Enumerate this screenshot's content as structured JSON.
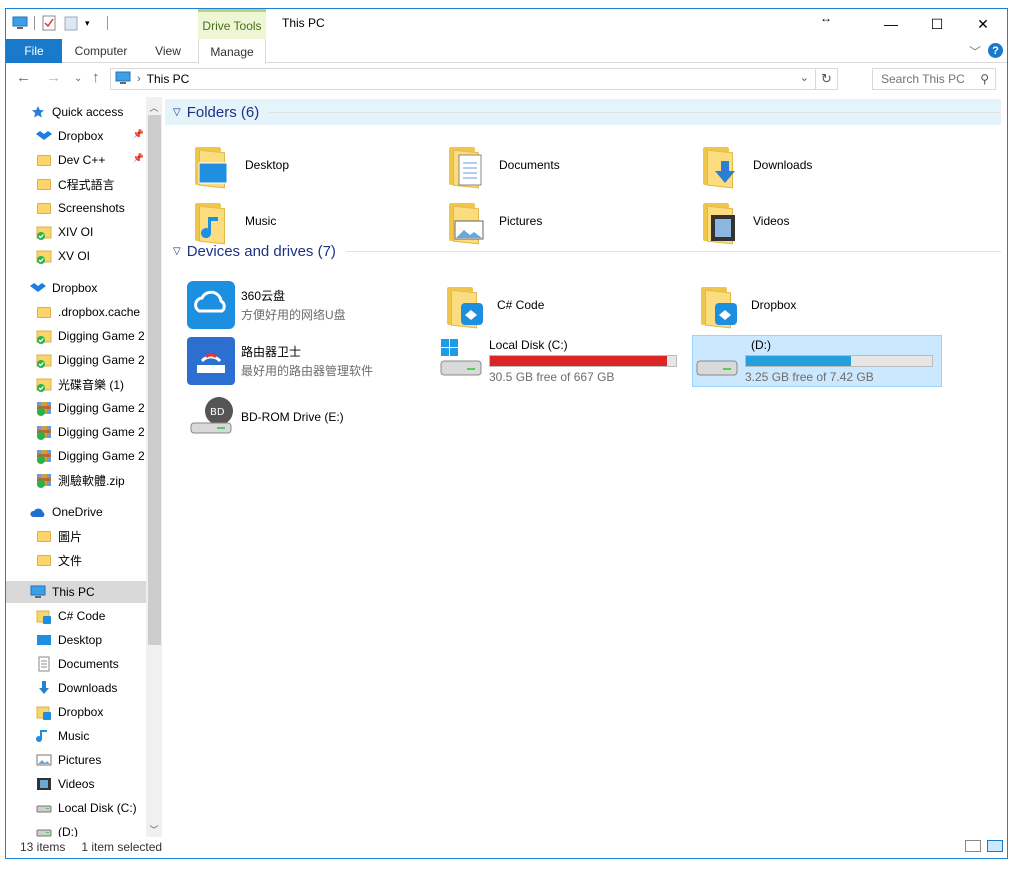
{
  "window": {
    "title": "This PC",
    "context_tab_group": "Drive Tools",
    "controls": {
      "minimize": "—",
      "maximize": "☐",
      "close": "✕"
    }
  },
  "ribbon": {
    "tabs": [
      "File",
      "Computer",
      "View",
      "Manage"
    ],
    "help": "?"
  },
  "address": {
    "path": "This PC",
    "search_placeholder": "Search This PC"
  },
  "nav": {
    "items": [
      {
        "label": "Quick access",
        "icon": "star-icon",
        "level": 0
      },
      {
        "label": "Dropbox",
        "icon": "dropbox-icon",
        "level": 1,
        "pinned": true
      },
      {
        "label": "Dev C++",
        "icon": "folder-icon",
        "level": 1,
        "pinned": true
      },
      {
        "label": "C程式語言",
        "icon": "folder-icon",
        "level": 1
      },
      {
        "label": "Screenshots",
        "icon": "folder-icon",
        "level": 1
      },
      {
        "label": "XIV OI",
        "icon": "folder-synced-icon",
        "level": 1
      },
      {
        "label": "XV OI",
        "icon": "folder-synced-icon",
        "level": 1
      },
      {
        "label": "Dropbox",
        "icon": "dropbox-icon",
        "level": 0
      },
      {
        "label": ".dropbox.cache",
        "icon": "folder-icon",
        "level": 1
      },
      {
        "label": "Digging Game 2",
        "icon": "folder-synced-icon",
        "level": 1
      },
      {
        "label": "Digging Game 2",
        "icon": "folder-synced-icon",
        "level": 1
      },
      {
        "label": "光碟音樂 (1)",
        "icon": "folder-synced-icon",
        "level": 1
      },
      {
        "label": "Digging Game 2",
        "icon": "archive-icon",
        "level": 1
      },
      {
        "label": "Digging Game 2",
        "icon": "archive-icon",
        "level": 1
      },
      {
        "label": "Digging Game 2",
        "icon": "archive-icon",
        "level": 1
      },
      {
        "label": "測驗軟體.zip",
        "icon": "archive-icon",
        "level": 1
      },
      {
        "label": "OneDrive",
        "icon": "cloud-icon",
        "level": 0
      },
      {
        "label": "圖片",
        "icon": "folder-icon",
        "level": 1
      },
      {
        "label": "文件",
        "icon": "folder-icon",
        "level": 1
      },
      {
        "label": "This PC",
        "icon": "computer-icon",
        "level": 0,
        "selected": true
      },
      {
        "label": "C# Code",
        "icon": "folder-dropbox-icon",
        "level": 1
      },
      {
        "label": "Desktop",
        "icon": "desktop-icon",
        "level": 1
      },
      {
        "label": "Documents",
        "icon": "documents-icon",
        "level": 1
      },
      {
        "label": "Downloads",
        "icon": "download-icon",
        "level": 1
      },
      {
        "label": "Dropbox",
        "icon": "folder-dropbox-icon",
        "level": 1
      },
      {
        "label": "Music",
        "icon": "music-icon",
        "level": 1
      },
      {
        "label": "Pictures",
        "icon": "pictures-icon",
        "level": 1
      },
      {
        "label": "Videos",
        "icon": "videos-icon",
        "level": 1
      },
      {
        "label": "Local Disk (C:)",
        "icon": "drive-icon",
        "level": 1
      },
      {
        "label": "(D:)",
        "icon": "drive-icon",
        "level": 1
      }
    ]
  },
  "main": {
    "folders_header": "Folders (6)",
    "folders": [
      {
        "label": "Desktop",
        "icon": "desktop-folder-icon"
      },
      {
        "label": "Documents",
        "icon": "documents-folder-icon"
      },
      {
        "label": "Downloads",
        "icon": "downloads-folder-icon"
      },
      {
        "label": "Music",
        "icon": "music-folder-icon"
      },
      {
        "label": "Pictures",
        "icon": "pictures-folder-icon"
      },
      {
        "label": "Videos",
        "icon": "videos-folder-icon"
      }
    ],
    "devices_header": "Devices and drives (7)",
    "apps": [
      {
        "label": "360云盘",
        "sub": "方便好用的网络U盘",
        "icon": "cloud-app-icon"
      },
      {
        "label": "路由器卫士",
        "sub": "最好用的路由器管理软件",
        "icon": "router-app-icon"
      }
    ],
    "special_folders": [
      {
        "label": "C# Code",
        "icon": "folder-dropbox-icon"
      },
      {
        "label": "Dropbox",
        "icon": "folder-dropbox-icon"
      }
    ],
    "drives": [
      {
        "label": "Local Disk (C:)",
        "free": "30.5 GB free of 667 GB",
        "used_fraction": 0.954,
        "bar_color": "#da2626"
      },
      {
        "label": "(D:)",
        "free": "3.25 GB free of 7.42 GB",
        "used_fraction": 0.562,
        "bar_color": "#26a0da"
      }
    ],
    "bd_drive": {
      "label": "BD-ROM Drive (E:)",
      "badge": "BD"
    }
  },
  "status": {
    "items": "13 items",
    "selected": "1 item selected"
  },
  "colors": {
    "accent": "#1979ca",
    "selection": "#cce8ff",
    "header_text": "#1e3287"
  }
}
